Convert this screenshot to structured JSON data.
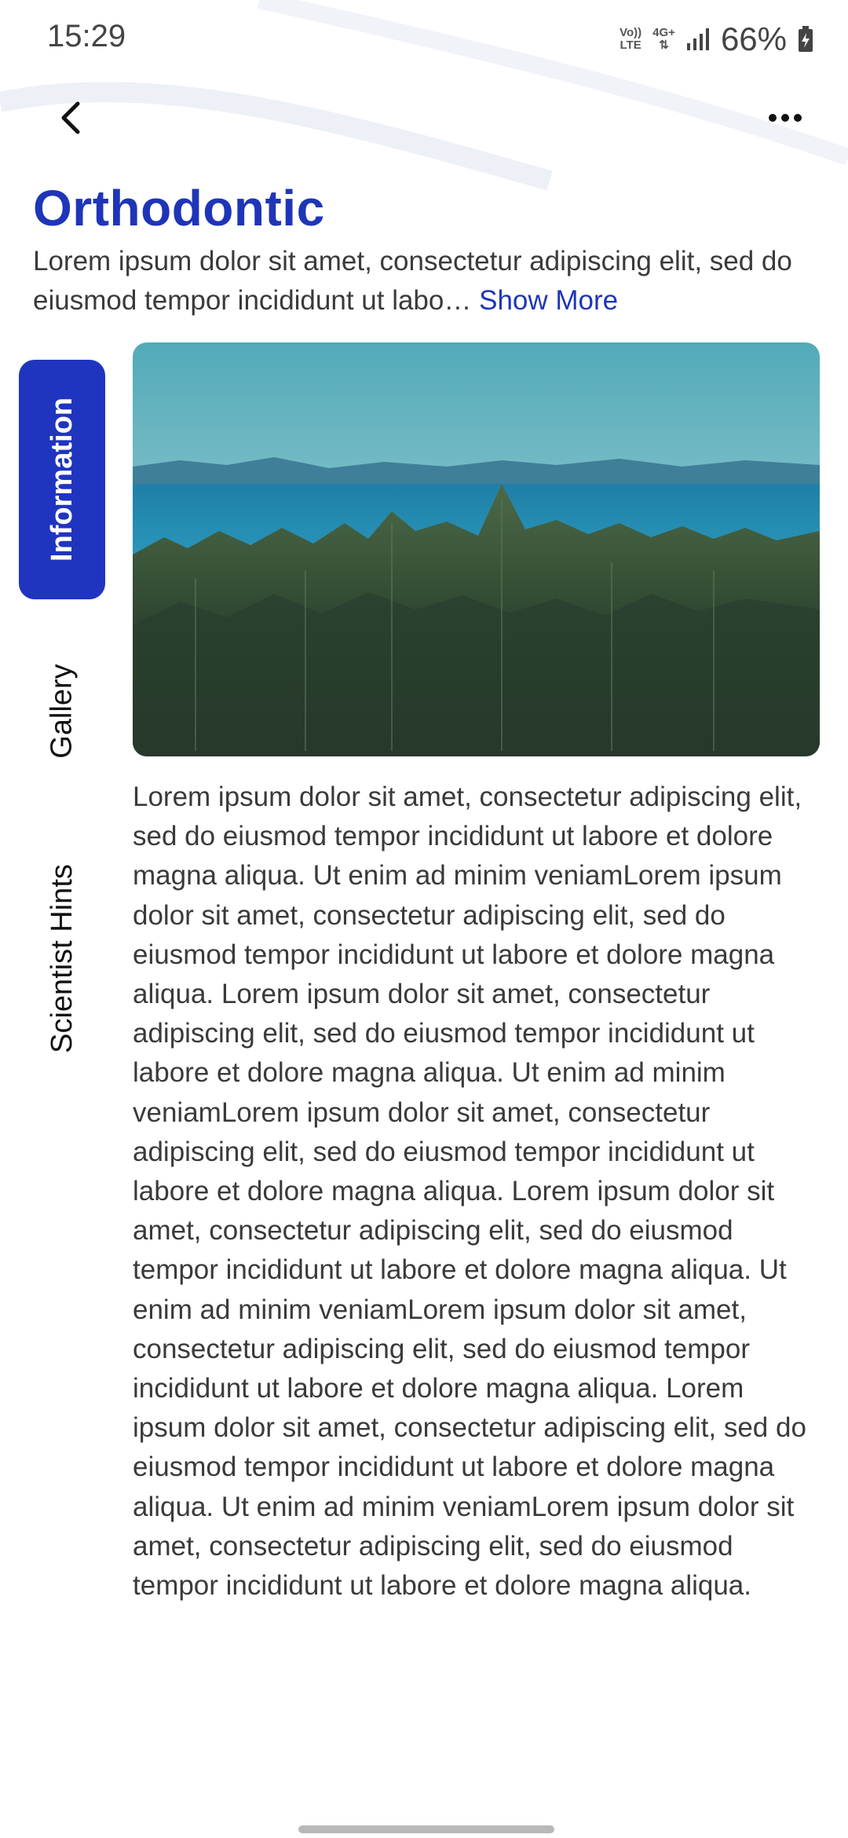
{
  "status_bar": {
    "time": "15:29",
    "volte_label_top": "Vo))",
    "volte_label_bottom": "LTE",
    "network_label": "4G+",
    "battery": "66%"
  },
  "header": {
    "back_icon": "chevron-left-icon",
    "more_icon": "more-horizontal-icon"
  },
  "page": {
    "title": "Orthodontic",
    "summary": "Lorem ipsum dolor sit amet, consectetur adipiscing elit, sed do eiusmod tempor incididunt ut labo… ",
    "show_more_label": "Show More"
  },
  "tabs": [
    {
      "label": "Information",
      "active": true
    },
    {
      "label": "Gallery",
      "active": false
    },
    {
      "label": "Scientist Hints",
      "active": false
    }
  ],
  "content": {
    "image": "landscape-photo-forest-lake-mountains",
    "body": "Lorem ipsum dolor sit amet, consectetur adipiscing elit, sed do eiusmod tempor incididunt ut labore et dolore magna aliqua. Ut enim ad minim veniamLorem ipsum dolor sit amet, consectetur adipiscing elit, sed do eiusmod tempor incididunt ut labore et dolore magna aliqua. Lorem ipsum dolor sit amet, consectetur adipiscing elit, sed do eiusmod tempor incididunt ut labore et dolore magna aliqua. Ut enim ad minim veniamLorem ipsum dolor sit amet, consectetur adipiscing elit, sed do eiusmod tempor incididunt ut labore et dolore magna aliqua. Lorem ipsum dolor sit amet, consectetur adipiscing elit, sed do eiusmod tempor incididunt ut labore et dolore magna aliqua. Ut enim ad minim veniamLorem ipsum dolor sit amet, consectetur adipiscing elit, sed do eiusmod tempor incididunt ut labore et dolore magna aliqua. Lorem ipsum dolor sit amet, consectetur adipiscing elit, sed do eiusmod tempor incididunt ut labore et dolore magna aliqua. Ut enim ad minim veniamLorem ipsum dolor sit amet, consectetur adipiscing elit, sed do eiusmod tempor incididunt ut labore et dolore magna aliqua."
  },
  "colors": {
    "accent": "#1f35c0",
    "title": "#1f35b8",
    "text": "#3a3a3a"
  }
}
